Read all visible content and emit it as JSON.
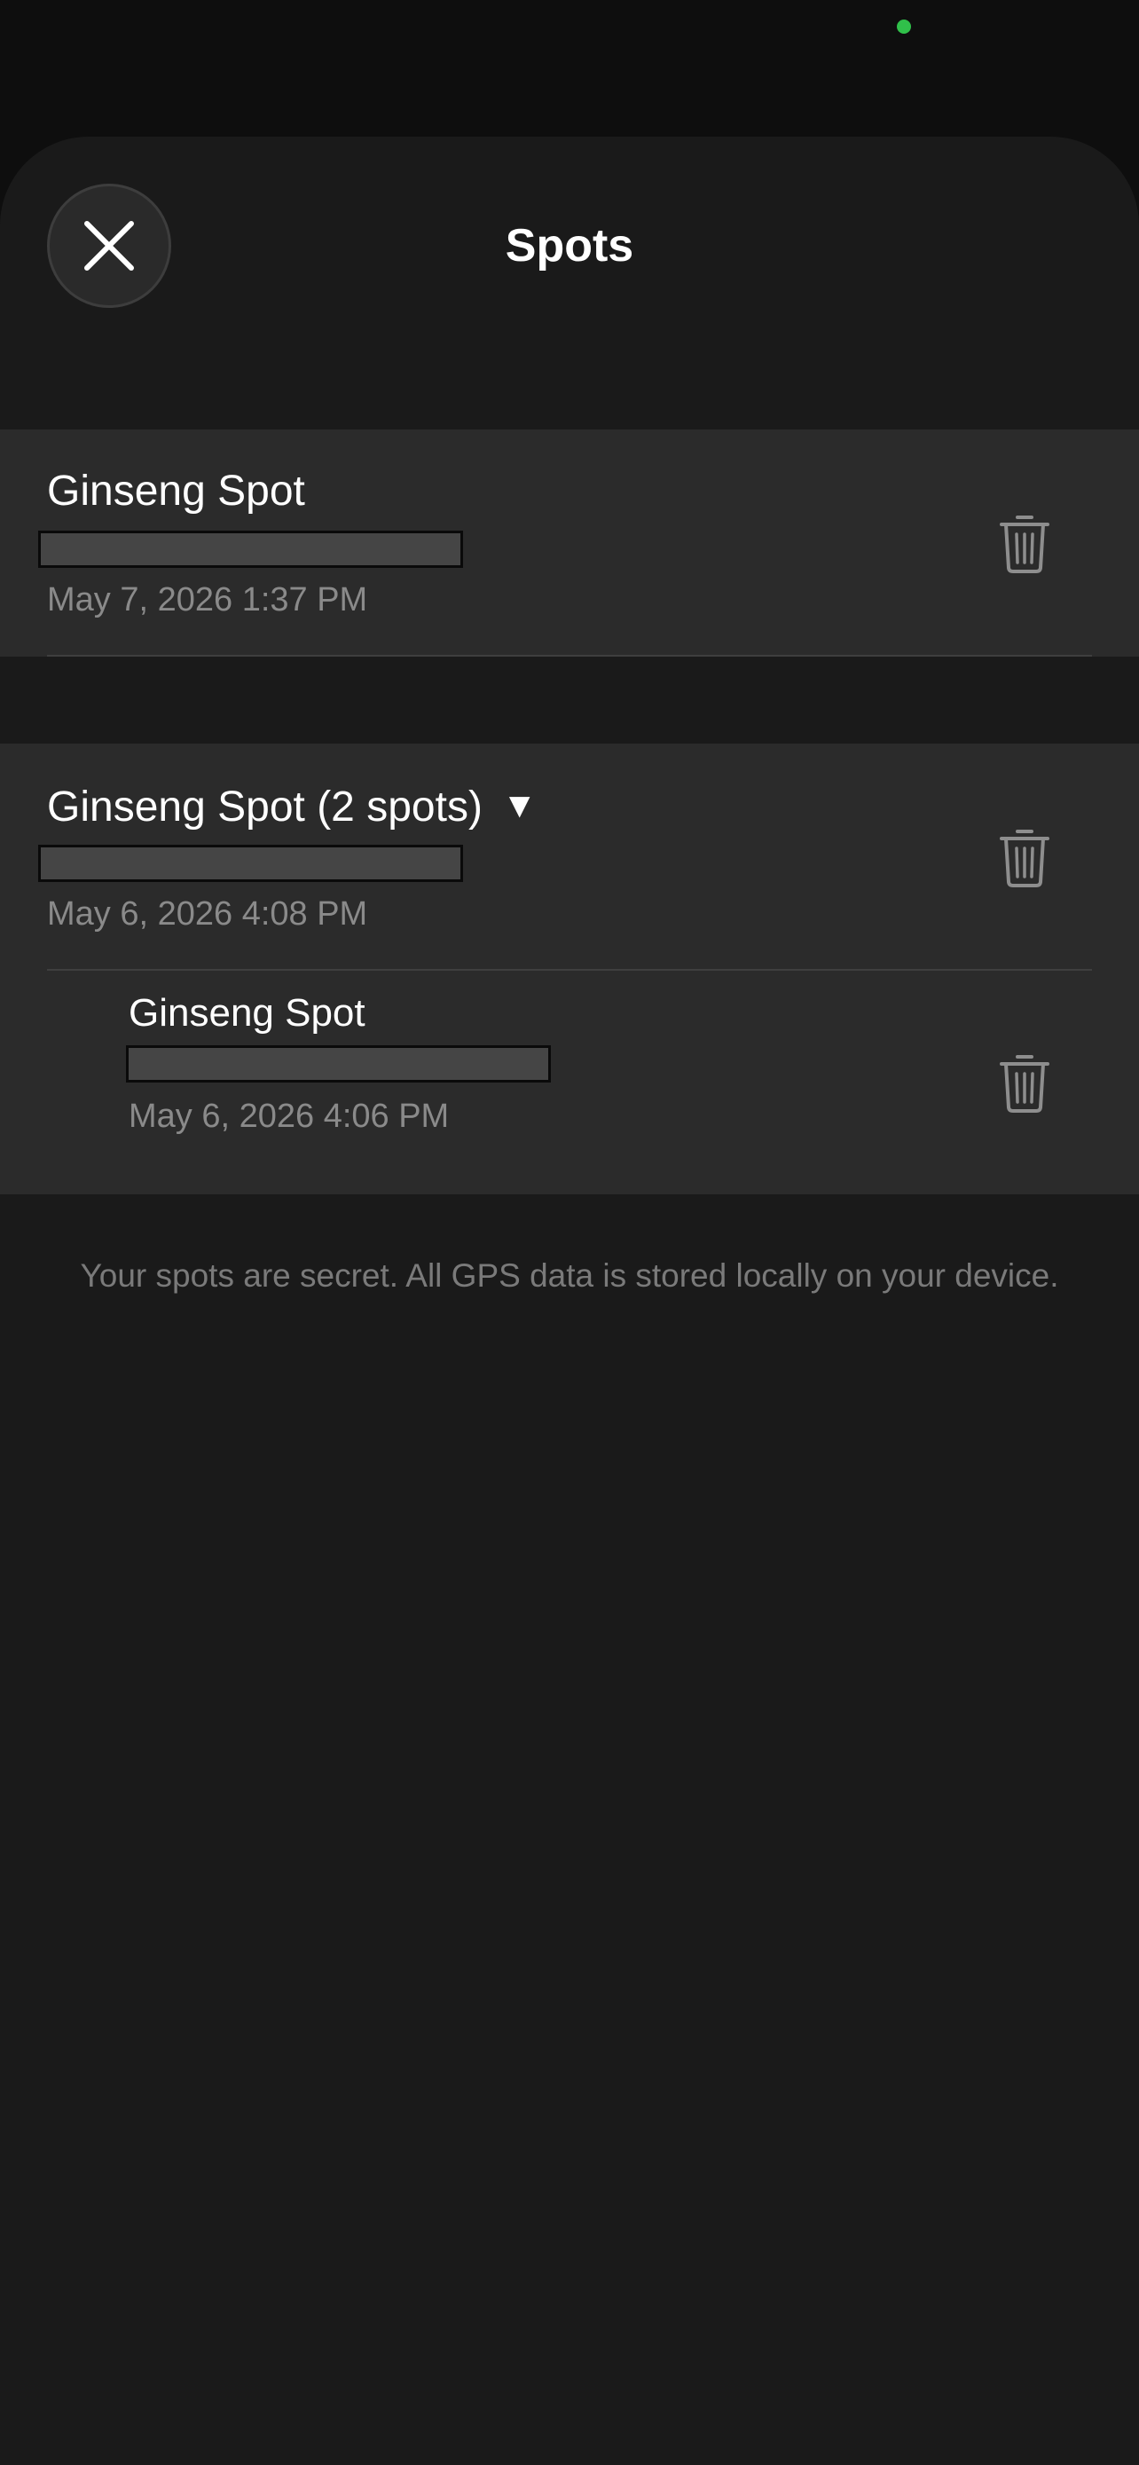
{
  "colors": {
    "status_dot": "#30c04a",
    "sheet_bg": "#1a1a1a",
    "row_bg": "#2b2b2b",
    "text_primary": "#ffffff",
    "text_secondary": "#8a8a8a",
    "icon_gray": "#8e8e8e"
  },
  "header": {
    "title": "Spots",
    "close_icon": "close-icon"
  },
  "spots": [
    {
      "name": "Ginseng Spot",
      "date": "May 7, 2026 1:37 PM",
      "delete_icon": "trash-icon"
    },
    {
      "name": "Ginseng Spot (2 spots)",
      "expand_glyph": "▼",
      "date": "May 6, 2026 4:08 PM",
      "delete_icon": "trash-icon",
      "children": [
        {
          "name": "Ginseng Spot",
          "date": "May 6, 2026 4:06 PM",
          "delete_icon": "trash-icon"
        }
      ]
    }
  ],
  "footer": {
    "note": "Your spots are secret. All GPS data is stored locally on your device."
  }
}
